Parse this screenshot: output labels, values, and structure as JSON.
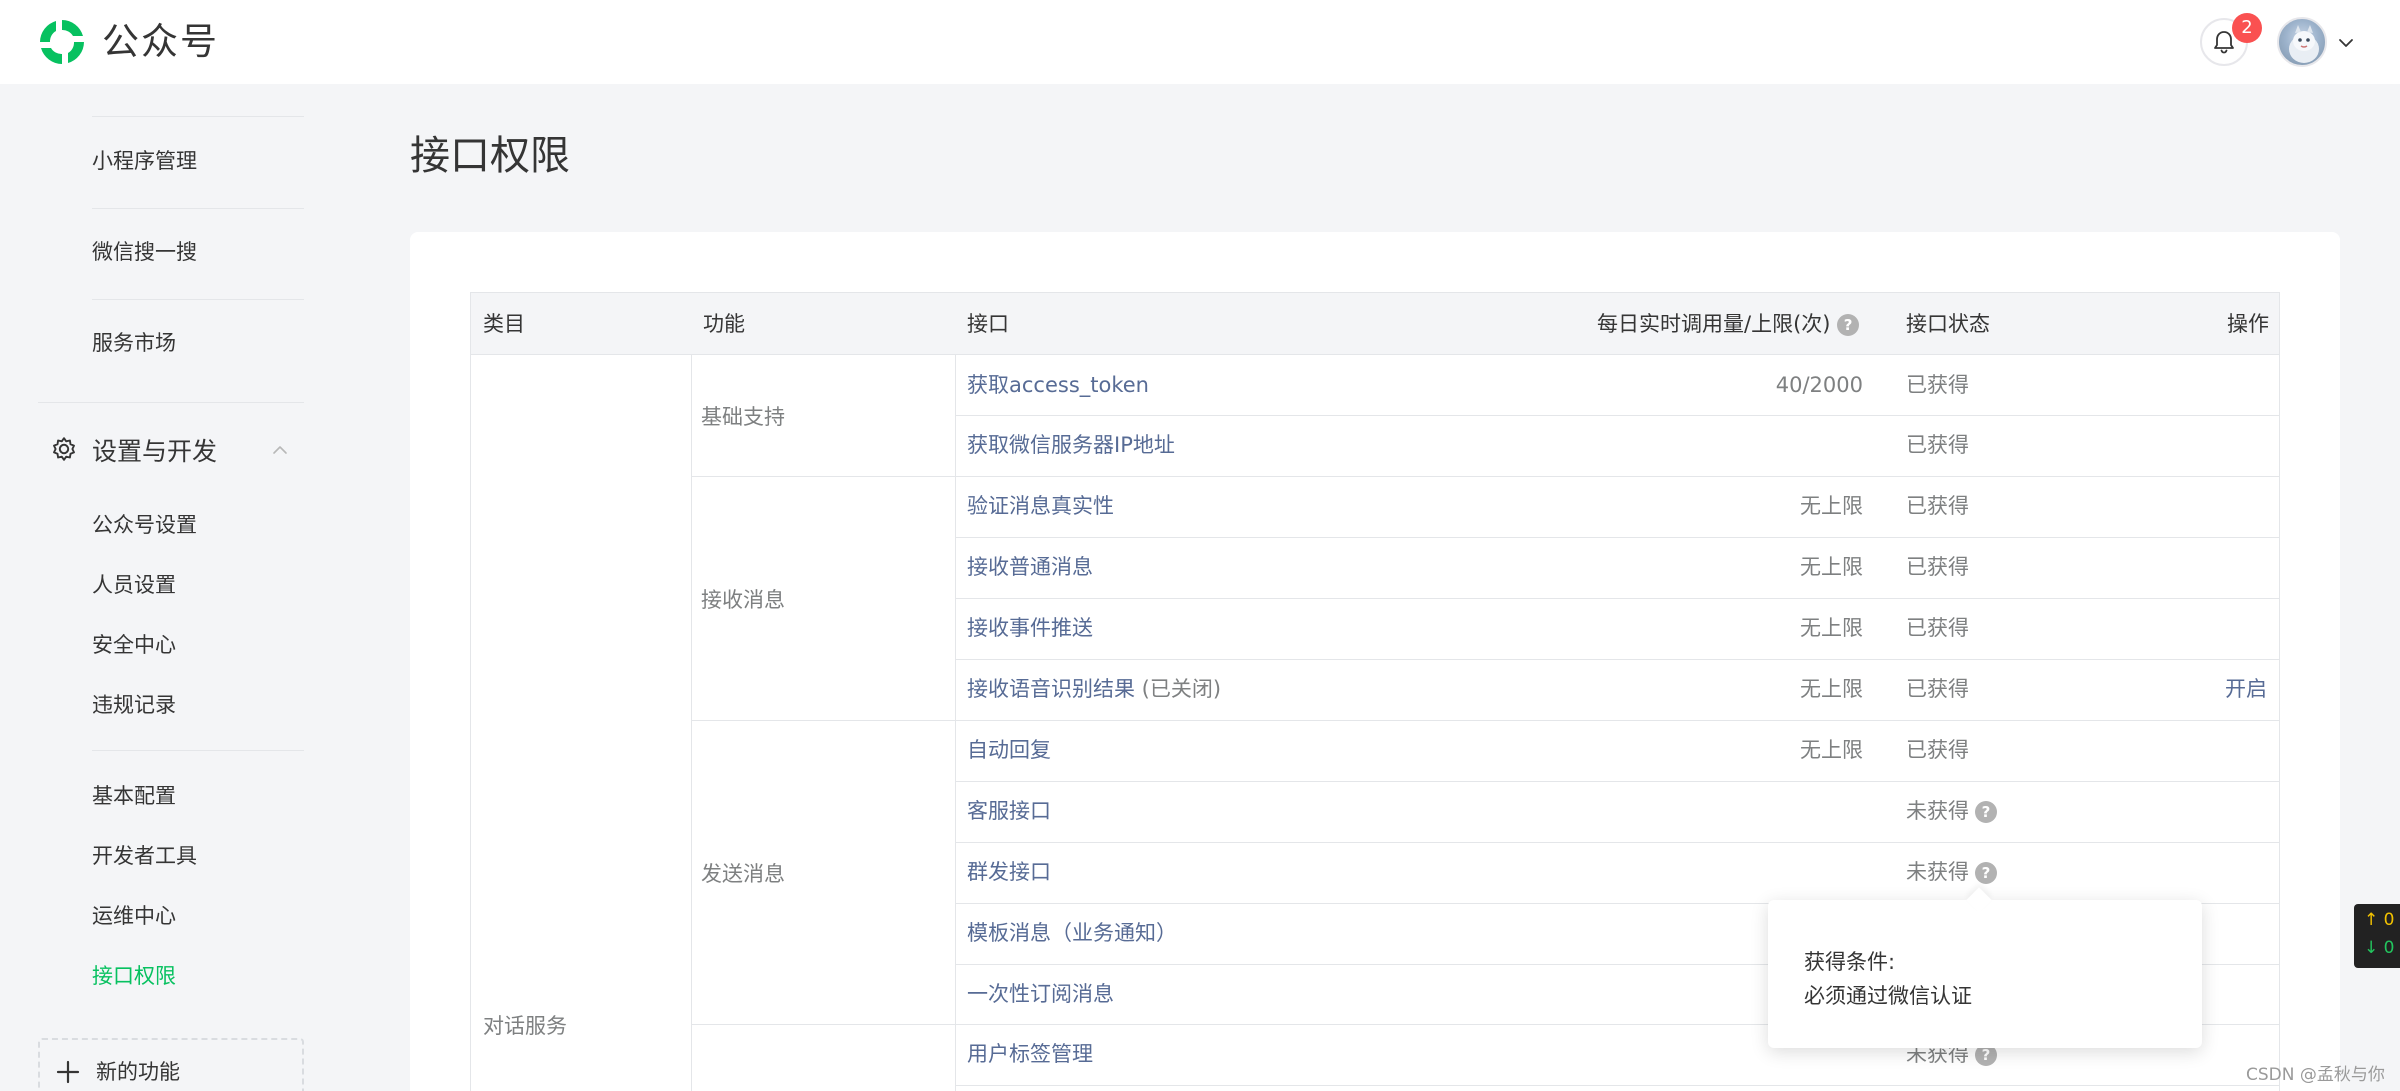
{
  "app": {
    "brand": "公众号",
    "notification_count": "2",
    "logo_icon": "wechat-official-logo-icon",
    "bell_icon": "bell-icon",
    "brand_color": "#07c160"
  },
  "sidebar": {
    "items_top": [
      {
        "label": "小程序管理"
      },
      {
        "label": "微信搜一搜"
      },
      {
        "label": "服务市场"
      }
    ],
    "group": {
      "label": "设置与开发",
      "icon": "gear-icon",
      "expanded": true
    },
    "items_group1": [
      {
        "label": "公众号设置"
      },
      {
        "label": "人员设置"
      },
      {
        "label": "安全中心"
      },
      {
        "label": "违规记录"
      }
    ],
    "items_group2": [
      {
        "label": "基本配置"
      },
      {
        "label": "开发者工具"
      },
      {
        "label": "运维中心"
      },
      {
        "label": "接口权限",
        "active": true
      }
    ],
    "new_feature": "新的功能"
  },
  "main": {
    "title": "接口权限",
    "table": {
      "headers": {
        "category": "类目",
        "function": "功能",
        "api": "接口",
        "quota": "每日实时调用量/上限(次)",
        "status": "接口状态",
        "action": "操作"
      },
      "category": "对话服务",
      "functions": [
        {
          "label": "基础支持"
        },
        {
          "label": "接收消息"
        },
        {
          "label": "发送消息"
        }
      ],
      "rows": [
        {
          "api": "获取access_token",
          "note": "",
          "quota": "40/2000",
          "status": "已获得",
          "help": false,
          "action": ""
        },
        {
          "api": "获取微信服务器IP地址",
          "note": "",
          "quota": "",
          "status": "已获得",
          "help": false,
          "action": ""
        },
        {
          "api": "验证消息真实性",
          "note": "",
          "quota": "无上限",
          "status": "已获得",
          "help": false,
          "action": ""
        },
        {
          "api": "接收普通消息",
          "note": "",
          "quota": "无上限",
          "status": "已获得",
          "help": false,
          "action": ""
        },
        {
          "api": "接收事件推送",
          "note": "",
          "quota": "无上限",
          "status": "已获得",
          "help": false,
          "action": ""
        },
        {
          "api": "接收语音识别结果",
          "note": " (已关闭)",
          "quota": "无上限",
          "status": "已获得",
          "help": false,
          "action": "开启"
        },
        {
          "api": "自动回复",
          "note": "",
          "quota": "无上限",
          "status": "已获得",
          "help": false,
          "action": ""
        },
        {
          "api": "客服接口",
          "note": "",
          "quota": "",
          "status": "未获得",
          "help": true,
          "action": ""
        },
        {
          "api": "群发接口",
          "note": "",
          "quota": "",
          "status": "未获得",
          "help": true,
          "action": ""
        },
        {
          "api": "模板消息（业务通知）",
          "note": "",
          "quota": "",
          "status": "",
          "help": false,
          "action": ""
        },
        {
          "api": "一次性订阅消息",
          "note": "",
          "quota": "",
          "status": "",
          "help": false,
          "action": ""
        },
        {
          "api": "用户标签管理",
          "note": "",
          "quota": "",
          "status": "未获得",
          "help": true,
          "action": ""
        }
      ]
    },
    "tooltip": {
      "title": "获得条件:",
      "body": "必须通过微信认证"
    }
  },
  "widget": {
    "up": "↑ 0",
    "down": "↓ 0"
  },
  "watermark": "CSDN @孟秋与你",
  "colors": {
    "link": "#576b95",
    "active": "#07c160",
    "badge": "#fa5151"
  }
}
